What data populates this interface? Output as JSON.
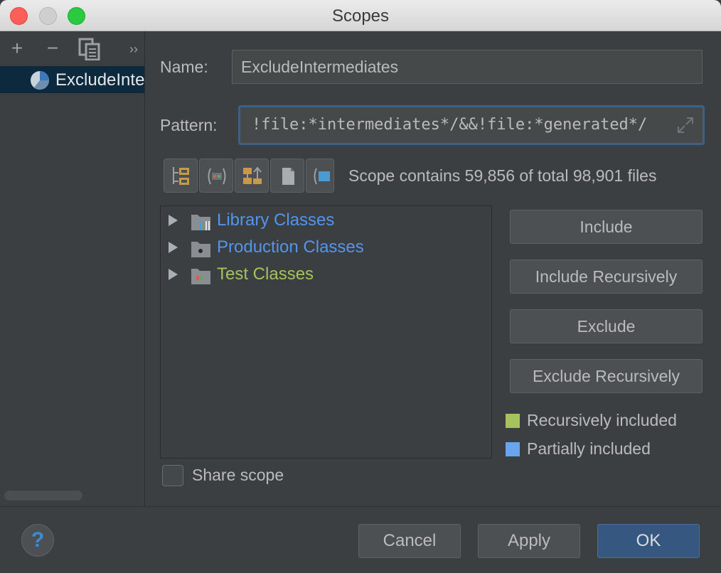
{
  "window": {
    "title": "Scopes"
  },
  "sidebar": {
    "add_label": "+",
    "remove_label": "−",
    "more_label": "››",
    "items": [
      {
        "label": "ExcludeIntermediates"
      }
    ]
  },
  "form": {
    "name_label": "Name:",
    "name_value": "ExcludeIntermediates",
    "pattern_label": "Pattern:",
    "pattern_value": "!file:*intermediates*/&&!file:*generated*/"
  },
  "scope_info": "Scope contains 59,856 of total 98,901 files",
  "tree": {
    "items": [
      {
        "label": "Library Classes",
        "color": "#5394ec"
      },
      {
        "label": "Production Classes",
        "color": "#5394ec"
      },
      {
        "label": "Test Classes",
        "color": "#a5c25c"
      }
    ]
  },
  "actions": {
    "include": "Include",
    "include_recursively": "Include Recursively",
    "exclude": "Exclude",
    "exclude_recursively": "Exclude Recursively"
  },
  "legend": [
    {
      "label": "Recursively included",
      "color": "#a5c25c"
    },
    {
      "label": "Partially included",
      "color": "#6aa3ee"
    }
  ],
  "share_scope": {
    "label": "Share scope",
    "checked": false
  },
  "footer": {
    "help_label": "?",
    "cancel": "Cancel",
    "apply": "Apply",
    "ok": "OK"
  }
}
